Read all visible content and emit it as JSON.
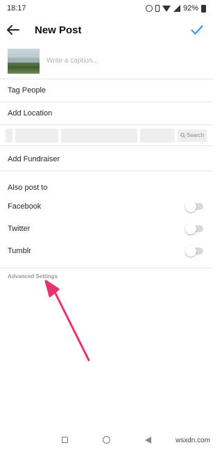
{
  "status": {
    "time": "18:17",
    "battery": "92%"
  },
  "header": {
    "title": "New Post"
  },
  "caption": {
    "placeholder": "Write a caption..."
  },
  "menu": {
    "tag_people": "Tag People",
    "add_location": "Add Location",
    "location_search": "Search",
    "add_fundraiser": "Add Fundraiser"
  },
  "share": {
    "section_label": "Also post to",
    "items": [
      {
        "label": "Facebook",
        "enabled": false
      },
      {
        "label": "Twitter",
        "enabled": false
      },
      {
        "label": "Tumblr",
        "enabled": false
      }
    ]
  },
  "advanced": {
    "label": "Advanced Settings"
  },
  "annotation": {
    "arrow_color": "#e8336a"
  },
  "colors": {
    "accent": "#3897f0",
    "toggle_off": "#d9d9d9"
  },
  "icons": [
    "back-arrow-icon",
    "checkmark-icon",
    "alarm-icon",
    "vibrate-icon",
    "wifi-icon",
    "signal-icon",
    "battery-icon",
    "search-icon",
    "recents-icon",
    "home-icon",
    "nav-back-icon"
  ],
  "watermark": "wsxdn.com"
}
